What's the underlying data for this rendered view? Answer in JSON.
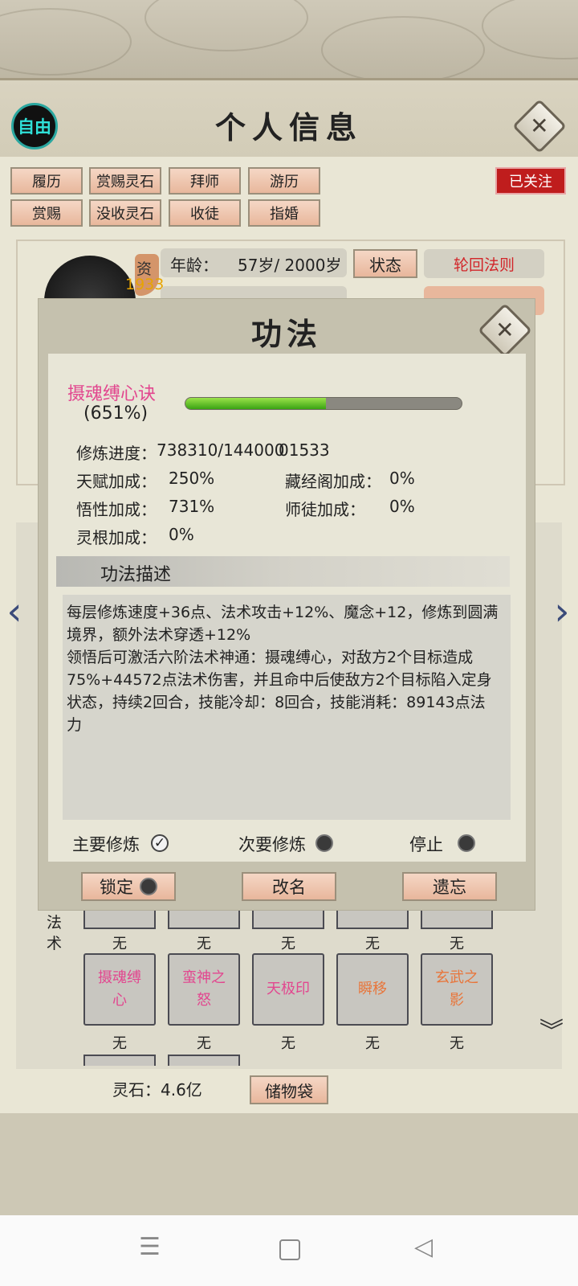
{
  "header": {
    "free_badge": "自由",
    "title": "个人信息",
    "close_icon": "close-icon"
  },
  "tabs": {
    "row1": [
      "履历",
      "赏赐灵石",
      "拜师",
      "游历"
    ],
    "row2": [
      "赏赐",
      "没收灵石",
      "收徒",
      "指婚"
    ],
    "followed": "已关注"
  },
  "profile": {
    "aptitude_label": "资",
    "aptitude_value": "1933",
    "age_label": "年龄：",
    "age_value": "57岁/ 2000岁",
    "status_button": "状态",
    "rebirth_button": "轮回法则"
  },
  "skills": {
    "section_label": "法术",
    "row_top_captions": [
      "无",
      "无",
      "无",
      "无",
      "无"
    ],
    "slots": [
      {
        "name": "摄魂缚心",
        "color": "#e2478f"
      },
      {
        "name": "蛮神之怒",
        "color": "#e2478f"
      },
      {
        "name": "天极印",
        "color": "#e2478f"
      },
      {
        "name": "瞬移",
        "color": "#e8753a"
      },
      {
        "name": "玄武之影",
        "color": "#e8753a"
      }
    ],
    "row_captions": [
      "无",
      "无",
      "无",
      "无",
      "无"
    ]
  },
  "footer": {
    "spirit_stone": "灵石：4.6亿",
    "bag_button": "储物袋"
  },
  "dialog": {
    "title": "功法",
    "technique_name": "摄魂缚心诀",
    "technique_percent": "(651%)",
    "progress_fraction": 0.51,
    "stats": {
      "progress_label": "修炼进度：",
      "progress_value": "738310/144000",
      "progress_overlap": "01533",
      "talent_label": "天赋加成：",
      "talent_value": "250%",
      "library_label": "藏经阁加成：",
      "library_value": "0%",
      "insight_label": "悟性加成：",
      "insight_value": "731%",
      "mentor_label": "师徒加成：",
      "mentor_value": "0%",
      "root_label": "灵根加成：",
      "root_value": "0%"
    },
    "desc_header": "功法描述",
    "description": "每层修炼速度+36点、法术攻击+12%、魔念+12，修炼到圆满\n境界，额外法术穿透+12%\n领悟后可激活六阶法术神通：摄魂缚心，对敌方2个目标造成\n75%+44572点法术伤害，并且命中后使敌方2个目标陷入定身\n状态，持续2回合，技能冷却：8回合，技能消耗：89143点法\n力",
    "modes": {
      "primary": "主要修炼",
      "secondary": "次要修炼",
      "stop": "停止"
    },
    "buttons": {
      "lock": "锁定",
      "rename": "改名",
      "forget": "遗忘"
    }
  },
  "colors": {
    "accent_pink": "#e2478f",
    "followed_red": "#bf1d1d",
    "progress_green": "#5cc02a"
  }
}
